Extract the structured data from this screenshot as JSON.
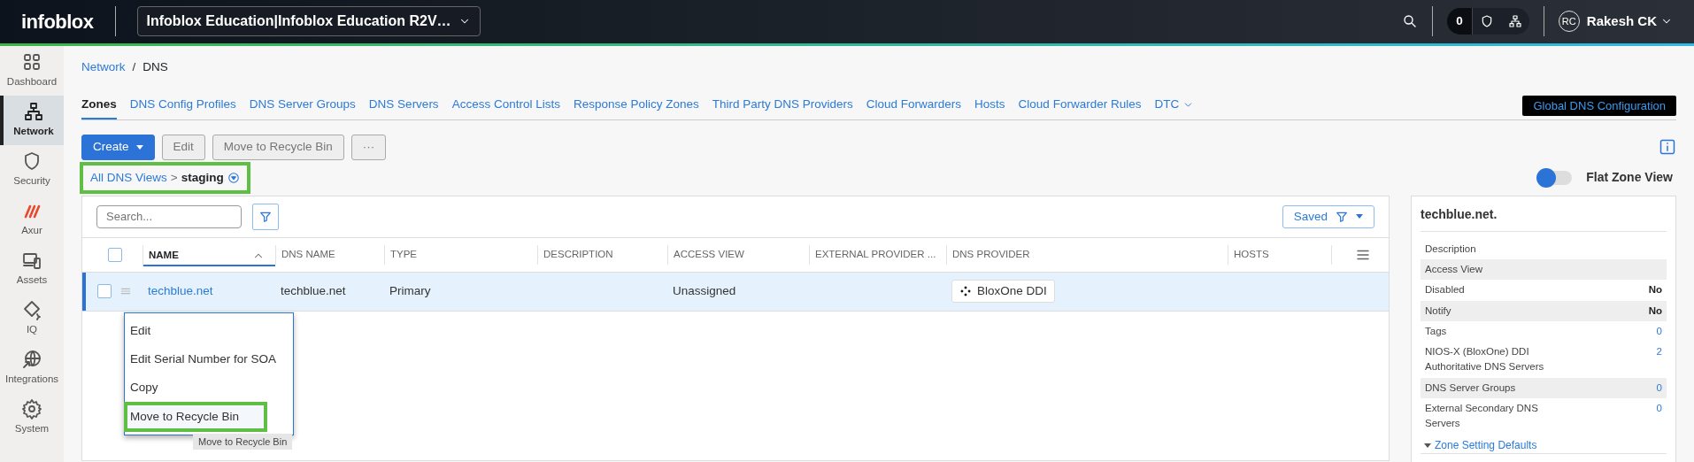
{
  "header": {
    "logo": "infoblox",
    "account": "Infoblox Education|Infoblox Education R2V…",
    "notifications": "0",
    "user_initials": "RC",
    "user_name": "Rakesh CK"
  },
  "sidebar": {
    "items": [
      {
        "label": "Dashboard",
        "kind": "dashboard",
        "selected": false
      },
      {
        "label": "Network",
        "kind": "network",
        "selected": true
      },
      {
        "label": "Security",
        "kind": "security",
        "selected": false
      },
      {
        "label": "Axur",
        "kind": "axur",
        "selected": false
      },
      {
        "label": "Assets",
        "kind": "assets",
        "selected": false
      },
      {
        "label": "IQ",
        "kind": "iq",
        "selected": false
      },
      {
        "label": "Integrations",
        "kind": "integrations",
        "selected": false
      },
      {
        "label": "System",
        "kind": "system",
        "selected": false
      }
    ]
  },
  "breadcrumb": {
    "items": [
      "Network",
      "DNS"
    ],
    "separator": "/"
  },
  "tabs": [
    {
      "label": "Zones",
      "selected": true,
      "has_menu": false
    },
    {
      "label": "DNS Config Profiles",
      "selected": false,
      "has_menu": false
    },
    {
      "label": "DNS Server Groups",
      "selected": false,
      "has_menu": false
    },
    {
      "label": "DNS Servers",
      "selected": false,
      "has_menu": false
    },
    {
      "label": "Access Control Lists",
      "selected": false,
      "has_menu": false
    },
    {
      "label": "Response Policy Zones",
      "selected": false,
      "has_menu": false
    },
    {
      "label": "Third Party DNS Providers",
      "selected": false,
      "has_menu": false
    },
    {
      "label": "Cloud Forwarders",
      "selected": false,
      "has_menu": false
    },
    {
      "label": "Hosts",
      "selected": false,
      "has_menu": false
    },
    {
      "label": "Cloud Forwarder Rules",
      "selected": false,
      "has_menu": false
    },
    {
      "label": "DTC",
      "selected": false,
      "has_menu": true
    }
  ],
  "global_button": "Global DNS Configuration",
  "toolbar": [
    {
      "label": "Create",
      "kind": "primary"
    },
    {
      "label": "Edit",
      "kind": "secondary"
    },
    {
      "label": "Move to Recycle Bin",
      "kind": "secondary"
    },
    {
      "label": "···",
      "kind": "secondary"
    }
  ],
  "view_path": {
    "root": "All DNS Views",
    "separator": ">",
    "current": "staging",
    "highlighted": true
  },
  "flat_zone_toggle": {
    "label": "Flat Zone View",
    "on": false
  },
  "table": {
    "search": {
      "placeholder": "Search..."
    },
    "saved_button": "Saved",
    "select_all_checked": false,
    "columns": [
      {
        "label": "NAME",
        "sorted": true
      },
      {
        "label": "DNS NAME",
        "sorted": false
      },
      {
        "label": "TYPE",
        "sorted": false
      },
      {
        "label": "DESCRIPTION",
        "sorted": false
      },
      {
        "label": "ACCESS VIEW",
        "sorted": false
      },
      {
        "label": "EXTERNAL PROVIDER ...",
        "sorted": false
      },
      {
        "label": "DNS PROVIDER",
        "sorted": false
      },
      {
        "label": "HOSTS",
        "sorted": false
      }
    ],
    "rows": [
      {
        "selected": true,
        "checked": false,
        "name": "techblue.net",
        "dns_name": "techblue.net",
        "type": "Primary",
        "access_view": "Unassigned",
        "dns_provider": "BloxOne DDI"
      }
    ]
  },
  "context_menu": {
    "items": [
      {
        "label": "Edit",
        "highlighted": false
      },
      {
        "label": "Edit Serial Number for SOA",
        "highlighted": false
      },
      {
        "label": "Copy",
        "highlighted": false
      },
      {
        "label": "Move to Recycle Bin",
        "highlighted": true
      }
    ],
    "tooltip": "Move to Recycle Bin"
  },
  "details": {
    "title": "techblue.net.",
    "rows": [
      {
        "label": "Description",
        "shaded": false
      },
      {
        "label": "Access View",
        "shaded": true
      },
      {
        "label": "Disabled",
        "value": "No",
        "kind": "flag",
        "shaded": false
      },
      {
        "label": "Notify",
        "value": "No",
        "kind": "flag",
        "shaded": true
      },
      {
        "label": "Tags",
        "value": "0",
        "kind": "count",
        "shaded": false
      },
      {
        "label": "NIOS-X (BloxOne) DDI Authoritative DNS Servers",
        "value": "2",
        "kind": "count",
        "shaded": false
      },
      {
        "label": "DNS Server Groups",
        "value": "0",
        "kind": "count",
        "shaded": true
      },
      {
        "label": "External Secondary DNS Servers",
        "value": "0",
        "kind": "count",
        "shaded": false
      }
    ],
    "section": "Zone Setting Defaults"
  }
}
